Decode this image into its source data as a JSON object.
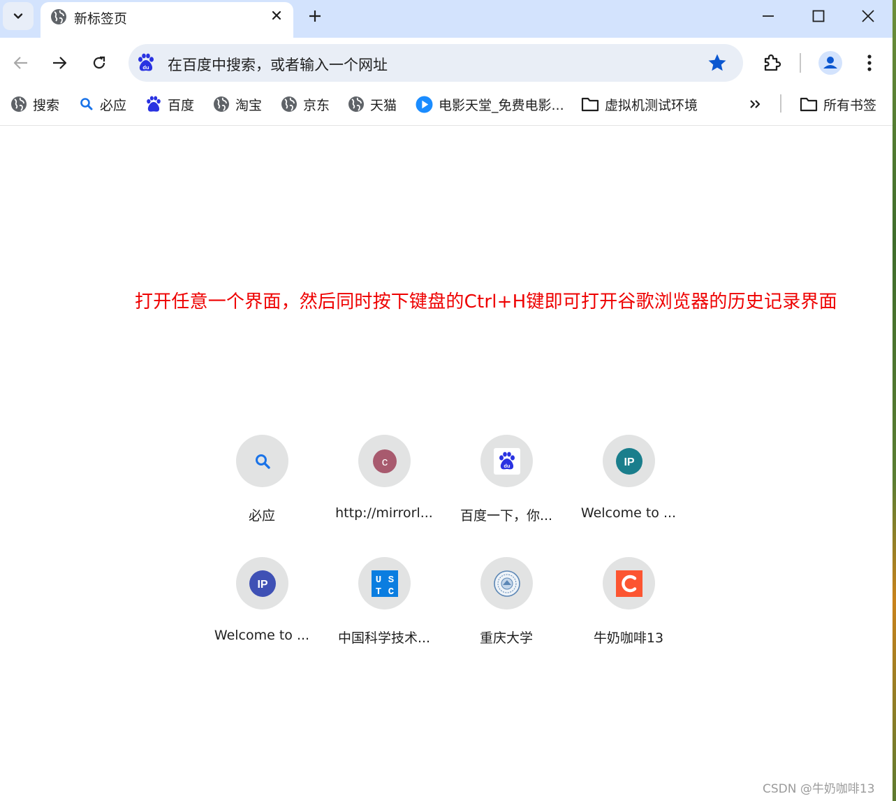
{
  "window": {
    "tab_title": "新标签页",
    "controls": {
      "minimize": "minimize-icon",
      "maximize": "maximize-icon",
      "close": "close-icon"
    }
  },
  "toolbar": {
    "omnibox_text": "在百度中搜索，或者输入一个网址"
  },
  "bookmarks": [
    {
      "label": "搜索",
      "icon": "globe-icon"
    },
    {
      "label": "必应",
      "icon": "search-icon"
    },
    {
      "label": "百度",
      "icon": "baidu-icon"
    },
    {
      "label": "淘宝",
      "icon": "globe-icon"
    },
    {
      "label": "京东",
      "icon": "globe-icon"
    },
    {
      "label": "天猫",
      "icon": "globe-icon"
    },
    {
      "label": "电影天堂_免费电影...",
      "icon": "play-icon"
    },
    {
      "label": "虚拟机测试环境",
      "icon": "folder-icon"
    }
  ],
  "all_bookmarks_label": "所有书签",
  "instruction": "打开任意一个界面，然后同时按下键盘的Ctrl+H键即可打开谷歌浏览器的历史记录界面",
  "shortcuts": [
    {
      "label": "必应",
      "icon": "search-icon"
    },
    {
      "label": "http://mirrorl...",
      "icon": "letter-c-icon"
    },
    {
      "label": "百度一下，你...",
      "icon": "baidu-icon"
    },
    {
      "label": "Welcome to ...",
      "icon": "ip-icon"
    },
    {
      "label": "Welcome to ...",
      "icon": "ip-icon"
    },
    {
      "label": "中国科学技术...",
      "icon": "ustc-icon"
    },
    {
      "label": "重庆大学",
      "icon": "university-seal-icon"
    },
    {
      "label": "牛奶咖啡13",
      "icon": "csdn-c-icon"
    }
  ],
  "watermark": "CSDN @牛奶咖啡13",
  "colors": {
    "tab_strip": "#d3e3fd",
    "omnibox": "#e9eef6",
    "star": "#0b57d0",
    "instruction_text": "#ee0000",
    "tile_circle": "#e2e3e3"
  }
}
